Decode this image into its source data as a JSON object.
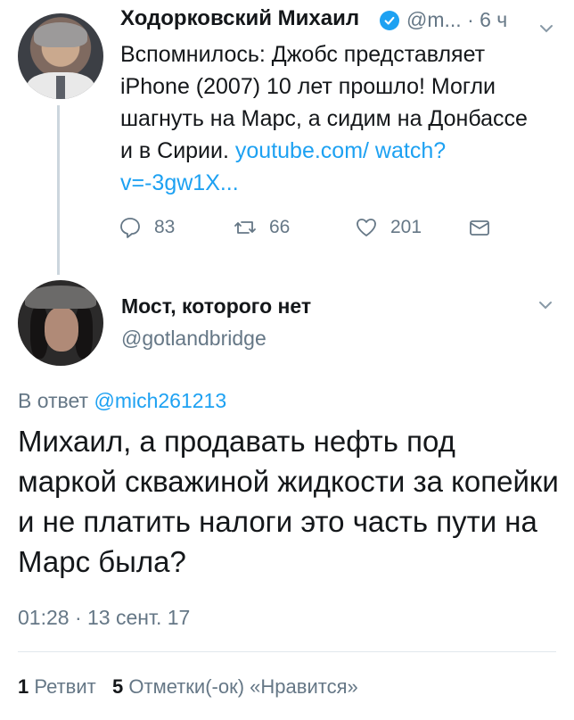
{
  "tweet1": {
    "name": "Ходорковский Михаил",
    "handle_time": "@m... · 6 ч",
    "text": "Вспомнилось: Джобс представляет iPhone (2007) 10 лет прошло! Могли шагнуть на Марс, а сидим на Донбассе и в Сирии. ",
    "link": "youtube.com/ watch?v=-3gw1X...",
    "replies": "83",
    "retweets": "66",
    "likes": "201"
  },
  "tweet2": {
    "name": "Мост, которого нет",
    "handle": "@gotlandbridge",
    "reply_prefix": "В ответ ",
    "reply_mention": "@mich261213",
    "text": "Михаил, а продавать нефть под маркой скважиной жидкости за копейки и не платить налоги это часть пути на Марс была?",
    "timestamp": "01:28 · 13 сент. 17",
    "retweet_count": "1",
    "retweet_label": " Ретвит   ",
    "like_count": "5",
    "like_label": " Отметки(-ок) «Нравится»"
  },
  "icons": {
    "verified": "verified-badge-icon",
    "reply": "reply-icon",
    "retweet": "retweet-icon",
    "like": "heart-icon",
    "dm": "envelope-icon",
    "menu": "chevron-down-icon"
  },
  "colors": {
    "accent": "#1da1f2",
    "muted": "#657786",
    "text": "#14171a"
  }
}
